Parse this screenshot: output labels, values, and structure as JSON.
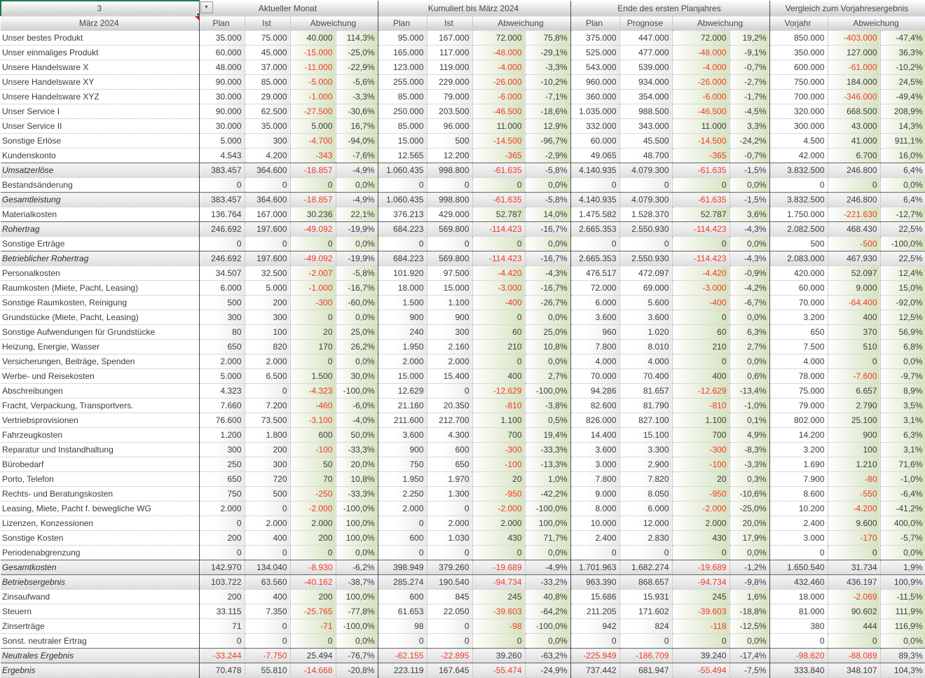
{
  "filter": {
    "selected_period": "März 2024",
    "active_cell_hint": "3",
    "dropdown_icon": "chevron-down",
    "dropdown_glyph": "▼"
  },
  "columns": {
    "month": {
      "title": "Aktueller Monat",
      "sub1": "Plan",
      "sub2": "Ist",
      "sub3": "Abweichung"
    },
    "cumulative": {
      "title": "Kumuliert bis März 2024",
      "sub1": "Plan",
      "sub2": "Ist",
      "sub3": "Abweichung"
    },
    "planyear": {
      "title": "Ende des ersten Planjahres",
      "sub1": "Plan",
      "sub2": "Prognose",
      "sub3": "Abweichung"
    },
    "prioryear": {
      "title": "Vergleich zum Vorjahresergebnis",
      "sub1": "Vorjahr",
      "sub2": "Abweichung"
    }
  },
  "rows": [
    {
      "label": "Unser bestes Produkt",
      "type": "item",
      "values": [
        "35.000",
        "75.000",
        "40.000",
        "114,3%",
        "95.000",
        "167.000",
        "72.000",
        "75,8%",
        "375.000",
        "447.000",
        "72.000",
        "19,2%",
        "850.000",
        "-403.000",
        "-47,4%"
      ]
    },
    {
      "label": "Unser einmaliges Produkt",
      "type": "item",
      "values": [
        "60.000",
        "45.000",
        "-15.000",
        "-25,0%",
        "165.000",
        "117.000",
        "-48.000",
        "-29,1%",
        "525.000",
        "477.000",
        "-48.000",
        "-9,1%",
        "350.000",
        "127.000",
        "36,3%"
      ]
    },
    {
      "label": "Unsere Handelsware X",
      "type": "item",
      "values": [
        "48.000",
        "37.000",
        "-11.000",
        "-22,9%",
        "123.000",
        "119.000",
        "-4.000",
        "-3,3%",
        "543.000",
        "539.000",
        "-4.000",
        "-0,7%",
        "600.000",
        "-61.000",
        "-10,2%"
      ]
    },
    {
      "label": "Unsere Handelsware XY",
      "type": "item",
      "values": [
        "90.000",
        "85.000",
        "-5.000",
        "-5,6%",
        "255.000",
        "229.000",
        "-26.000",
        "-10,2%",
        "960.000",
        "934.000",
        "-26.000",
        "-2,7%",
        "750.000",
        "184.000",
        "24,5%"
      ]
    },
    {
      "label": "Unsere Handelsware XYZ",
      "type": "item",
      "values": [
        "30.000",
        "29.000",
        "-1.000",
        "-3,3%",
        "85.000",
        "79.000",
        "-6.000",
        "-7,1%",
        "360.000",
        "354.000",
        "-6.000",
        "-1,7%",
        "700.000",
        "-346.000",
        "-49,4%"
      ]
    },
    {
      "label": "Unser Service I",
      "type": "item",
      "values": [
        "90.000",
        "62.500",
        "-27.500",
        "-30,6%",
        "250.000",
        "203.500",
        "-46.500",
        "-18,6%",
        "1.035.000",
        "988.500",
        "-46.500",
        "-4,5%",
        "320.000",
        "668.500",
        "208,9%"
      ]
    },
    {
      "label": "Unser Service II",
      "type": "item",
      "values": [
        "30.000",
        "35.000",
        "5.000",
        "16,7%",
        "85.000",
        "96.000",
        "11.000",
        "12,9%",
        "332.000",
        "343.000",
        "11.000",
        "3,3%",
        "300.000",
        "43.000",
        "14,3%"
      ]
    },
    {
      "label": "Sonstige Erlöse",
      "type": "item",
      "values": [
        "5.000",
        "300",
        "-4.700",
        "-94,0%",
        "15.000",
        "500",
        "-14.500",
        "-96,7%",
        "60.000",
        "45.500",
        "-14.500",
        "-24,2%",
        "4.500",
        "41.000",
        "911,1%"
      ]
    },
    {
      "label": "Kundenskonto",
      "type": "item",
      "values": [
        "4.543",
        "4.200",
        "-343",
        "-7,6%",
        "12.565",
        "12.200",
        "-365",
        "-2,9%",
        "49.065",
        "48.700",
        "-365",
        "-0,7%",
        "42.000",
        "6.700",
        "16,0%"
      ]
    },
    {
      "label": "Umsatzerlöse",
      "type": "total",
      "values": [
        "383.457",
        "364.600",
        "-18.857",
        "-4,9%",
        "1.060.435",
        "998.800",
        "-61.635",
        "-5,8%",
        "4.140.935",
        "4.079.300",
        "-61.635",
        "-1,5%",
        "3.832.500",
        "246.800",
        "6,4%"
      ]
    },
    {
      "label": "Bestandsänderung",
      "type": "item",
      "values": [
        "0",
        "0",
        "0",
        "0,0%",
        "0",
        "0",
        "0",
        "0,0%",
        "0",
        "0",
        "0",
        "0,0%",
        "0",
        "0",
        "0,0%"
      ]
    },
    {
      "label": "Gesamtleistung",
      "type": "total",
      "values": [
        "383.457",
        "364.600",
        "-18.857",
        "-4,9%",
        "1.060.435",
        "998.800",
        "-61.635",
        "-5,8%",
        "4.140.935",
        "4.079.300",
        "-61.635",
        "-1,5%",
        "3.832.500",
        "246.800",
        "6,4%"
      ]
    },
    {
      "label": "Materialkosten",
      "type": "item",
      "values": [
        "136.764",
        "167.000",
        "30.236",
        "22,1%",
        "376.213",
        "429.000",
        "52.787",
        "14,0%",
        "1.475.582",
        "1.528.370",
        "52.787",
        "3,6%",
        "1.750.000",
        "-221.630",
        "-12,7%"
      ]
    },
    {
      "label": "Rohertrag",
      "type": "total",
      "values": [
        "246.692",
        "197.600",
        "-49.092",
        "-19,9%",
        "684.223",
        "569.800",
        "-114.423",
        "-16,7%",
        "2.665.353",
        "2.550.930",
        "-114.423",
        "-4,3%",
        "2.082.500",
        "468.430",
        "22,5%"
      ]
    },
    {
      "label": "Sonstige Erträge",
      "type": "item",
      "values": [
        "0",
        "0",
        "0",
        "0,0%",
        "0",
        "0",
        "0",
        "0,0%",
        "0",
        "0",
        "0",
        "0,0%",
        "500",
        "-500",
        "-100,0%"
      ]
    },
    {
      "label": "Betrieblicher Rohertrag",
      "type": "total",
      "values": [
        "246.692",
        "197.600",
        "-49.092",
        "-19,9%",
        "684.223",
        "569.800",
        "-114.423",
        "-16,7%",
        "2.665.353",
        "2.550.930",
        "-114.423",
        "-4,3%",
        "2.083.000",
        "467.930",
        "22,5%"
      ]
    },
    {
      "label": "Personalkosten",
      "type": "item",
      "values": [
        "34.507",
        "32.500",
        "-2.007",
        "-5,8%",
        "101.920",
        "97.500",
        "-4.420",
        "-4,3%",
        "476.517",
        "472.097",
        "-4.420",
        "-0,9%",
        "420.000",
        "52.097",
        "12,4%"
      ]
    },
    {
      "label": "Raumkosten (Miete, Pacht, Leasing)",
      "type": "item",
      "values": [
        "6.000",
        "5.000",
        "-1.000",
        "-16,7%",
        "18.000",
        "15.000",
        "-3.000",
        "-16,7%",
        "72.000",
        "69.000",
        "-3.000",
        "-4,2%",
        "60.000",
        "9.000",
        "15,0%"
      ]
    },
    {
      "label": "Sonstige Raumkosten, Reinigung",
      "type": "item",
      "values": [
        "500",
        "200",
        "-300",
        "-60,0%",
        "1.500",
        "1.100",
        "-400",
        "-26,7%",
        "6.000",
        "5.600",
        "-400",
        "-6,7%",
        "70.000",
        "-64.400",
        "-92,0%"
      ]
    },
    {
      "label": "Grundstücke (Miete, Pacht, Leasing)",
      "type": "item",
      "values": [
        "300",
        "300",
        "0",
        "0,0%",
        "900",
        "900",
        "0",
        "0,0%",
        "3.600",
        "3.600",
        "0",
        "0,0%",
        "3.200",
        "400",
        "12,5%"
      ]
    },
    {
      "label": "Sonstige Aufwendungen für Grundstücke",
      "type": "item",
      "values": [
        "80",
        "100",
        "20",
        "25,0%",
        "240",
        "300",
        "60",
        "25,0%",
        "960",
        "1.020",
        "60",
        "6,3%",
        "650",
        "370",
        "56,9%"
      ]
    },
    {
      "label": "Heizung, Energie, Wasser",
      "type": "item",
      "values": [
        "650",
        "820",
        "170",
        "26,2%",
        "1.950",
        "2.160",
        "210",
        "10,8%",
        "7.800",
        "8.010",
        "210",
        "2,7%",
        "7.500",
        "510",
        "6,8%"
      ]
    },
    {
      "label": "Versicherungen, Beiträge, Spenden",
      "type": "item",
      "values": [
        "2.000",
        "2.000",
        "0",
        "0,0%",
        "2.000",
        "2.000",
        "0",
        "0,0%",
        "4.000",
        "4.000",
        "0",
        "0,0%",
        "4.000",
        "0",
        "0,0%"
      ]
    },
    {
      "label": "Werbe- und Reisekosten",
      "type": "item",
      "values": [
        "5.000",
        "6.500",
        "1.500",
        "30,0%",
        "15.000",
        "15.400",
        "400",
        "2,7%",
        "70.000",
        "70.400",
        "400",
        "0,6%",
        "78.000",
        "-7.600",
        "-9,7%"
      ]
    },
    {
      "label": "Abschreibungen",
      "type": "item",
      "values": [
        "4.323",
        "0",
        "-4.323",
        "-100,0%",
        "12.629",
        "0",
        "-12.629",
        "-100,0%",
        "94.286",
        "81.657",
        "-12.629",
        "-13,4%",
        "75.000",
        "6.657",
        "8,9%"
      ]
    },
    {
      "label": "Fracht, Verpackung, Transportvers.",
      "type": "item",
      "values": [
        "7.660",
        "7.200",
        "-460",
        "-6,0%",
        "21.160",
        "20.350",
        "-810",
        "-3,8%",
        "82.600",
        "81.790",
        "-810",
        "-1,0%",
        "79.000",
        "2.790",
        "3,5%"
      ]
    },
    {
      "label": "Vertriebsprovisionen",
      "type": "item",
      "values": [
        "76.600",
        "73.500",
        "-3.100",
        "-4,0%",
        "211.600",
        "212.700",
        "1.100",
        "0,5%",
        "826.000",
        "827.100",
        "1.100",
        "0,1%",
        "802.000",
        "25.100",
        "3,1%"
      ]
    },
    {
      "label": "Fahrzeugkosten",
      "type": "item",
      "values": [
        "1.200",
        "1.800",
        "600",
        "50,0%",
        "3.600",
        "4.300",
        "700",
        "19,4%",
        "14.400",
        "15.100",
        "700",
        "4,9%",
        "14.200",
        "900",
        "6,3%"
      ]
    },
    {
      "label": "Reparatur und Instandhaltung",
      "type": "item",
      "values": [
        "300",
        "200",
        "-100",
        "-33,3%",
        "900",
        "600",
        "-300",
        "-33,3%",
        "3.600",
        "3.300",
        "-300",
        "-8,3%",
        "3.200",
        "100",
        "3,1%"
      ]
    },
    {
      "label": "Bürobedarf",
      "type": "item",
      "values": [
        "250",
        "300",
        "50",
        "20,0%",
        "750",
        "650",
        "-100",
        "-13,3%",
        "3.000",
        "2.900",
        "-100",
        "-3,3%",
        "1.690",
        "1.210",
        "71,6%"
      ]
    },
    {
      "label": "Porto, Telefon",
      "type": "item",
      "values": [
        "650",
        "720",
        "70",
        "10,8%",
        "1.950",
        "1.970",
        "20",
        "1,0%",
        "7.800",
        "7.820",
        "20",
        "0,3%",
        "7.900",
        "-80",
        "-1,0%"
      ]
    },
    {
      "label": "Rechts- und Beratungskosten",
      "type": "item",
      "values": [
        "750",
        "500",
        "-250",
        "-33,3%",
        "2.250",
        "1.300",
        "-950",
        "-42,2%",
        "9.000",
        "8.050",
        "-950",
        "-10,6%",
        "8.600",
        "-550",
        "-6,4%"
      ]
    },
    {
      "label": "Leasing, Miete, Pacht f. bewegliche WG",
      "type": "item",
      "values": [
        "2.000",
        "0",
        "-2.000",
        "-100,0%",
        "2.000",
        "0",
        "-2.000",
        "-100,0%",
        "8.000",
        "6.000",
        "-2.000",
        "-25,0%",
        "10.200",
        "-4.200",
        "-41,2%"
      ]
    },
    {
      "label": "Lizenzen, Konzessionen",
      "type": "item",
      "values": [
        "0",
        "2.000",
        "2.000",
        "100,0%",
        "0",
        "2.000",
        "2.000",
        "100,0%",
        "10.000",
        "12.000",
        "2.000",
        "20,0%",
        "2.400",
        "9.600",
        "400,0%"
      ]
    },
    {
      "label": "Sonstige Kosten",
      "type": "item",
      "values": [
        "200",
        "400",
        "200",
        "100,0%",
        "600",
        "1.030",
        "430",
        "71,7%",
        "2.400",
        "2.830",
        "430",
        "17,9%",
        "3.000",
        "-170",
        "-5,7%"
      ]
    },
    {
      "label": "Periodenabgrenzung",
      "type": "item",
      "values": [
        "0",
        "0",
        "0",
        "0,0%",
        "0",
        "0",
        "0",
        "0,0%",
        "0",
        "0",
        "0",
        "0,0%",
        "0",
        "0",
        "0,0%"
      ]
    },
    {
      "label": "Gesamtkosten",
      "type": "total",
      "values": [
        "142.970",
        "134.040",
        "-8.930",
        "-6,2%",
        "398.949",
        "379.260",
        "-19.689",
        "-4,9%",
        "1.701.963",
        "1.682.274",
        "-19.689",
        "-1,2%",
        "1.650.540",
        "31.734",
        "1,9%"
      ]
    },
    {
      "label": "Betriebsergebnis",
      "type": "total",
      "values": [
        "103.722",
        "63.560",
        "-40.162",
        "-38,7%",
        "285.274",
        "190.540",
        "-94.734",
        "-33,2%",
        "963.390",
        "868.657",
        "-94.734",
        "-9,8%",
        "432.460",
        "436.197",
        "100,9%"
      ]
    },
    {
      "label": "Zinsaufwand",
      "type": "item",
      "values": [
        "200",
        "400",
        "200",
        "100,0%",
        "600",
        "845",
        "245",
        "40,8%",
        "15.686",
        "15.931",
        "245",
        "1,6%",
        "18.000",
        "-2.069",
        "-11,5%"
      ]
    },
    {
      "label": "Steuern",
      "type": "item",
      "values": [
        "33.115",
        "7.350",
        "-25.765",
        "-77,8%",
        "61.653",
        "22.050",
        "-39.603",
        "-64,2%",
        "211.205",
        "171.602",
        "-39.603",
        "-18,8%",
        "81.000",
        "90.602",
        "111,9%"
      ]
    },
    {
      "label": "Zinserträge",
      "type": "item",
      "values": [
        "71",
        "0",
        "-71",
        "-100,0%",
        "98",
        "0",
        "-98",
        "-100,0%",
        "942",
        "824",
        "-118",
        "-12,5%",
        "380",
        "444",
        "116,9%"
      ]
    },
    {
      "label": "Sonst. neutraler Ertrag",
      "type": "item",
      "values": [
        "0",
        "0",
        "0",
        "0,0%",
        "0",
        "0",
        "0",
        "0,0%",
        "0",
        "0",
        "0",
        "0,0%",
        "0",
        "0",
        "0,0%"
      ]
    },
    {
      "label": "Neutrales Ergebnis",
      "type": "total",
      "values": [
        "-33.244",
        "-7.750",
        "25.494",
        "-76,7%",
        "-62.155",
        "-22.895",
        "39.260",
        "-63,2%",
        "-225.949",
        "-186.709",
        "39.240",
        "-17,4%",
        "-98.620",
        "-88.089",
        "89,3%"
      ]
    },
    {
      "label": "Ergebnis",
      "type": "total",
      "values": [
        "70.478",
        "55.810",
        "-14.668",
        "-20,8%",
        "223.119",
        "167.645",
        "-55.474",
        "-24,9%",
        "737.442",
        "681.947",
        "-55.494",
        "-7,5%",
        "333.840",
        "348.107",
        "104,3%"
      ]
    }
  ]
}
